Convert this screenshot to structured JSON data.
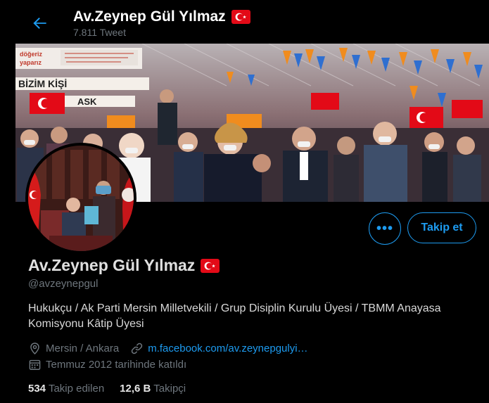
{
  "header": {
    "title": "Av.Zeynep Gül Yılmaz",
    "tweet_count": "7.811 Tweet"
  },
  "banner": {
    "signs": [
      "döğeriz",
      "yaparız",
      "BİZİM KİŞİ",
      "ASK"
    ]
  },
  "profile": {
    "name": "Av.Zeynep Gül Yılmaz",
    "handle": "@avzeynepgul",
    "bio": "Hukukçu / Ak Parti Mersin Milletvekili / Grup Disiplin Kurulu Üyesi / TBMM Anayasa Komisyonu Kâtip Üyesi",
    "location": "Mersin / Ankara",
    "link": "m.facebook.com/av.zeynepgulyi…",
    "joined": "Temmuz 2012 tarihinde katıldı",
    "following_count": "534",
    "following_label": "Takip edilen",
    "followers_count": "12,6 B",
    "followers_label": "Takipçi"
  },
  "actions": {
    "more_label": "•••",
    "follow_label": "Takip et"
  },
  "colors": {
    "accent": "#1d9bf0",
    "background": "#000000",
    "muted": "#6e767d",
    "flag_red": "#e30a17"
  },
  "icons": [
    "back-arrow-icon",
    "turkey-flag-icon",
    "location-icon",
    "link-icon",
    "calendar-icon"
  ]
}
